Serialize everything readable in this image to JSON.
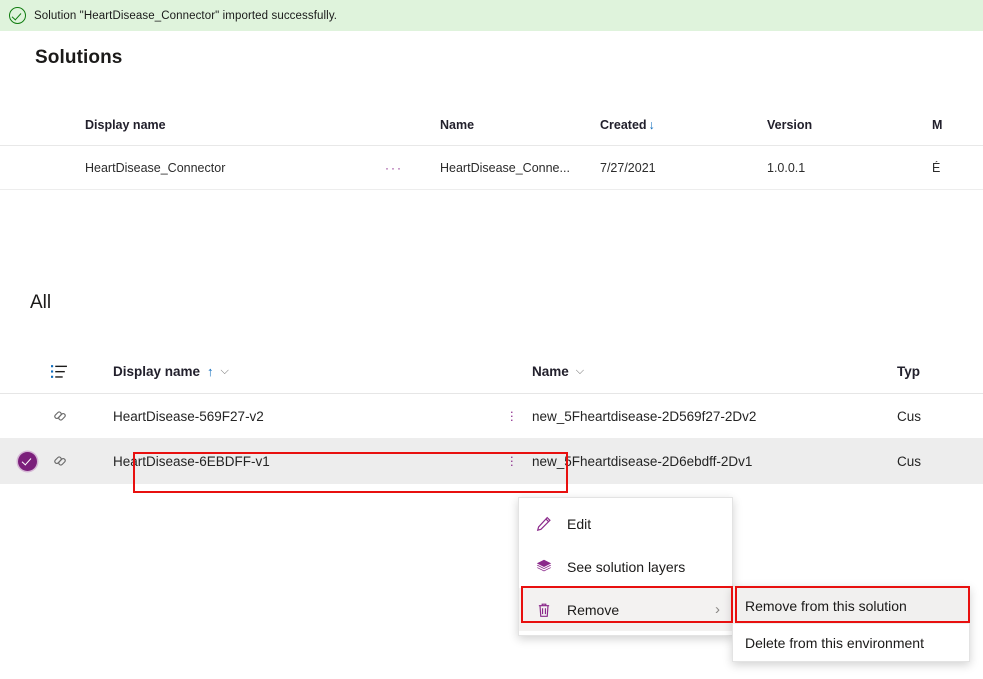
{
  "banner": {
    "icon": "check-circle-icon",
    "message": "Solution \"HeartDisease_Connector\" imported successfully."
  },
  "page": {
    "title": "Solutions",
    "section_title": "All"
  },
  "solutions_table": {
    "columns": [
      "Display name",
      "Name",
      "Created",
      "Version",
      "M"
    ],
    "sorted_column": "Created",
    "sort_direction": "↓",
    "rows": [
      {
        "display_name": "HeartDisease_Connector",
        "overflow": "···",
        "name": "HeartDisease_Conne...",
        "created": "7/27/2021",
        "version": "1.0.0.1",
        "managed": "É"
      }
    ]
  },
  "all_table": {
    "columns": {
      "sort_icon": "list-sort-icon",
      "display_name": "Display name",
      "display_name_sort": "↑",
      "display_name_chevron": "⌵",
      "name": "Name",
      "name_chevron": "⌵",
      "type": "Typ"
    },
    "rows": [
      {
        "selected": false,
        "type_icon": "connector-icon",
        "display_name": "HeartDisease-569F27-v2",
        "name": "new_5Fheartdisease-2D569f27-2Dv2",
        "type": "Cus"
      },
      {
        "selected": true,
        "type_icon": "connector-icon",
        "display_name": "HeartDisease-6EBDFF-v1",
        "name": "new_5Fheartdisease-2D6ebdff-2Dv1",
        "type": "Cus"
      }
    ]
  },
  "context_menu": {
    "items": [
      {
        "icon": "pencil-icon",
        "label": "Edit",
        "has_submenu": false
      },
      {
        "icon": "layers-icon",
        "label": "See solution layers",
        "has_submenu": false
      },
      {
        "icon": "trash-icon",
        "label": "Remove",
        "has_submenu": true,
        "chevron": "›",
        "highlighted": true
      }
    ]
  },
  "submenu": {
    "items": [
      {
        "label": "Remove from this solution",
        "highlighted": true
      },
      {
        "label": "Delete from this environment",
        "highlighted": false
      }
    ]
  },
  "colors": {
    "banner_bg": "#dff3dc",
    "banner_accent": "#107c10",
    "accent_purple": "#7b1f7b",
    "annotation_red": "#e8100f",
    "selected_row_bg": "#ededed",
    "sort_blue": "#0f6cbd"
  }
}
